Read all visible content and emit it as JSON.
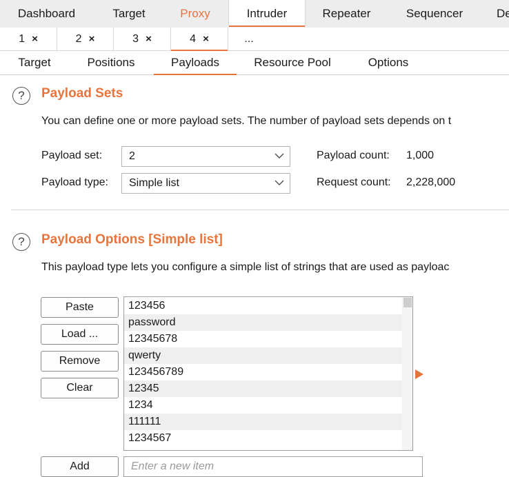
{
  "top_tabs": [
    "Dashboard",
    "Target",
    "Proxy",
    "Intruder",
    "Repeater",
    "Sequencer",
    "De"
  ],
  "number_tabs": [
    {
      "label": "1",
      "close": "×"
    },
    {
      "label": "2",
      "close": "×"
    },
    {
      "label": "3",
      "close": "×"
    },
    {
      "label": "4",
      "close": "×"
    },
    {
      "label": "..."
    }
  ],
  "sub_tabs": [
    "Target",
    "Positions",
    "Payloads",
    "Resource Pool",
    "Options"
  ],
  "payload_sets": {
    "title": "Payload Sets",
    "description": "You can define one or more payload sets. The number of payload sets depends on t",
    "set_label": "Payload set:",
    "set_value": "2",
    "type_label": "Payload type:",
    "type_value": "Simple list",
    "payload_count_label": "Payload count:",
    "payload_count_value": "1,000",
    "request_count_label": "Request count:",
    "request_count_value": "2,228,000"
  },
  "payload_options": {
    "title": "Payload Options [Simple list]",
    "description": "This payload type lets you configure a simple list of strings that are used as payloac",
    "buttons": {
      "paste": "Paste",
      "load": "Load ...",
      "remove": "Remove",
      "clear": "Clear",
      "add": "Add"
    },
    "items": [
      "123456",
      "password",
      "12345678",
      "qwerty",
      "123456789",
      "12345",
      "1234",
      "111111",
      "1234567"
    ],
    "new_item_placeholder": "Enter a new item"
  },
  "colors": {
    "accent": "#e8743b",
    "row_alt": "#efefef"
  },
  "icons": {
    "help": "help-icon",
    "dropdown": "chevron-down-icon",
    "arrow": "arrow-right-icon"
  },
  "help_glyph": "?"
}
